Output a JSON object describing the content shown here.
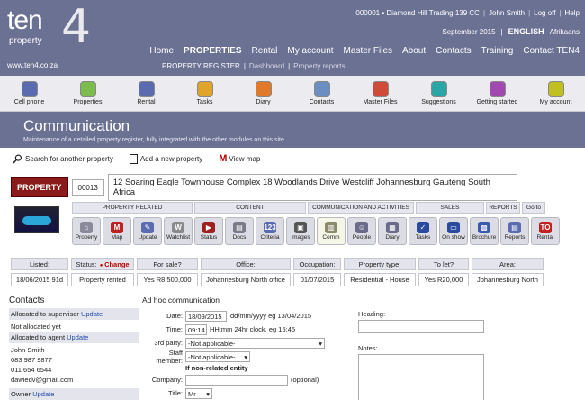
{
  "header": {
    "logo_ten": "ten",
    "logo_four": "4",
    "logo_property": "property",
    "site": "www.ten4.co.za",
    "top_links": [
      "000001 • Diamond Hill Trading 139 CC",
      "John Smith",
      "Log off",
      "Help"
    ],
    "date": "September 2015",
    "language": "ENGLISH",
    "alt_language": "Afrikaans",
    "nav": [
      "Home",
      "PROPERTIES",
      "Rental",
      "My account",
      "Master Files",
      "About",
      "Contacts",
      "Training",
      "Contact TEN4"
    ],
    "subnav": [
      "PROPERTY REGISTER",
      "Dashboard",
      "Property reports"
    ]
  },
  "toolbar": [
    {
      "label": "Cell phone",
      "icon": "phone-icon",
      "color": "#5a6bb0"
    },
    {
      "label": "Properties",
      "icon": "house-icon",
      "color": "#7cbb4c"
    },
    {
      "label": "Rental",
      "icon": "grid-icon",
      "color": "#5a6bb0"
    },
    {
      "label": "Tasks",
      "icon": "pin-icon",
      "color": "#e0a42a"
    },
    {
      "label": "Diary",
      "icon": "calendar-icon",
      "color": "#e07a2a"
    },
    {
      "label": "Contacts",
      "icon": "person-icon",
      "color": "#6a8fc0"
    },
    {
      "label": "Master Files",
      "icon": "files-icon",
      "color": "#d04a3a"
    },
    {
      "label": "Suggestions",
      "icon": "monitor-icon",
      "color": "#2aa6a6"
    },
    {
      "label": "Getting started",
      "icon": "power-icon",
      "color": "#a04ab0"
    },
    {
      "label": "My account",
      "icon": "gear-icon",
      "color": "#c0c020"
    }
  ],
  "page": {
    "title": "Communication",
    "subtitle": "Maintenance of a detailed property register, fully integrated with the other modules on this site"
  },
  "actions": {
    "search": "Search for another property",
    "add": "Add a new property",
    "map_m": "M",
    "map": "View map"
  },
  "property": {
    "button": "PROPERTY",
    "number": "00013",
    "address": "12 Soaring Eagle Townhouse Complex 18 Woodlands Drive Westcliff Johannesburg Gauteng South Africa"
  },
  "sections": [
    "PROPERTY RELATED",
    "CONTENT",
    "COMMUNICATION AND ACTIVITIES",
    "SALES",
    "REPORTS",
    "Go to"
  ],
  "icon_buttons": [
    {
      "label": "Property",
      "color": "#8a8a9a",
      "glyph": "⌂"
    },
    {
      "label": "Map",
      "color": "#c02020",
      "glyph": "M"
    },
    {
      "label": "Update",
      "color": "#5a6bb0",
      "glyph": "✎"
    },
    {
      "label": "Watchlist",
      "color": "#8a8a8a",
      "glyph": "W"
    },
    {
      "label": "Status",
      "color": "#a02020",
      "glyph": "▶"
    },
    {
      "label": "Docs",
      "color": "#7a7a8a",
      "glyph": "▤"
    },
    {
      "label": "Criteria",
      "color": "#5a6bb0",
      "glyph": "123"
    },
    {
      "label": "Images",
      "color": "#555",
      "glyph": "▣"
    },
    {
      "label": "Comm",
      "color": "#8a8a6a",
      "glyph": "▥"
    },
    {
      "label": "People",
      "color": "#6a6a8a",
      "glyph": "☺"
    },
    {
      "label": "Diary",
      "color": "#6a6a8a",
      "glyph": "▦"
    },
    {
      "label": "Tasks",
      "color": "#2a4aa0",
      "glyph": "✓"
    },
    {
      "label": "On show",
      "color": "#2a4aa0",
      "glyph": "▭"
    },
    {
      "label": "Brochure",
      "color": "#3a5ab0",
      "glyph": "▩"
    },
    {
      "label": "Reports",
      "color": "#5a6bb0",
      "glyph": "▤"
    },
    {
      "label": "Rental",
      "color": "#c02020",
      "glyph": "TO"
    }
  ],
  "summary": [
    {
      "head": "Listed:",
      "value": "18/06/2015 91d"
    },
    {
      "head": "Status:",
      "head_link": "Change",
      "value": "Property rented"
    },
    {
      "head": "For sale?",
      "value": "Yes  R8,500,000"
    },
    {
      "head": "Office:",
      "value": "Johannesburg North office"
    },
    {
      "head": "Occupation:",
      "value": "01/07/2015"
    },
    {
      "head": "Property type:",
      "value": "Residential - House"
    },
    {
      "head": "To let?",
      "value": "Yes  R20,000"
    },
    {
      "head": "Area:",
      "value": "Johannesburg North"
    }
  ],
  "contacts": {
    "title": "Contacts",
    "supervisor_label": "Allocated to supervisor",
    "supervisor_link": "Update",
    "supervisor_value": "Not allocated yet",
    "agent_label": "Allocated to agent",
    "agent_link": "Update",
    "agent_lines": [
      "John Smith",
      "083 987 9877",
      "011 654 6544",
      "dawiedv@gmail.com"
    ],
    "owner_label": "Owner",
    "owner_link": "Update"
  },
  "adhoc": {
    "title": "Ad hoc communication",
    "date_label": "Date:",
    "date_value": "18/09/2015",
    "date_hint": "dd/mm/yyyy eg 13/04/2015",
    "time_label": "Time:",
    "time_value": "09:14",
    "time_hint": "HH:mm 24hr clock, eg 15:45",
    "third_label": "3rd party:",
    "third_value": "-Not applicable-",
    "staff_label": "Staff member:",
    "staff_value": "-Not applicable-",
    "nonrel": "If non-related entity",
    "company_label": "Company:",
    "company_hint": "(optional)",
    "title_label": "Title:",
    "title_value": "Mr"
  },
  "right": {
    "heading_label": "Heading:",
    "notes_label": "Notes:"
  }
}
